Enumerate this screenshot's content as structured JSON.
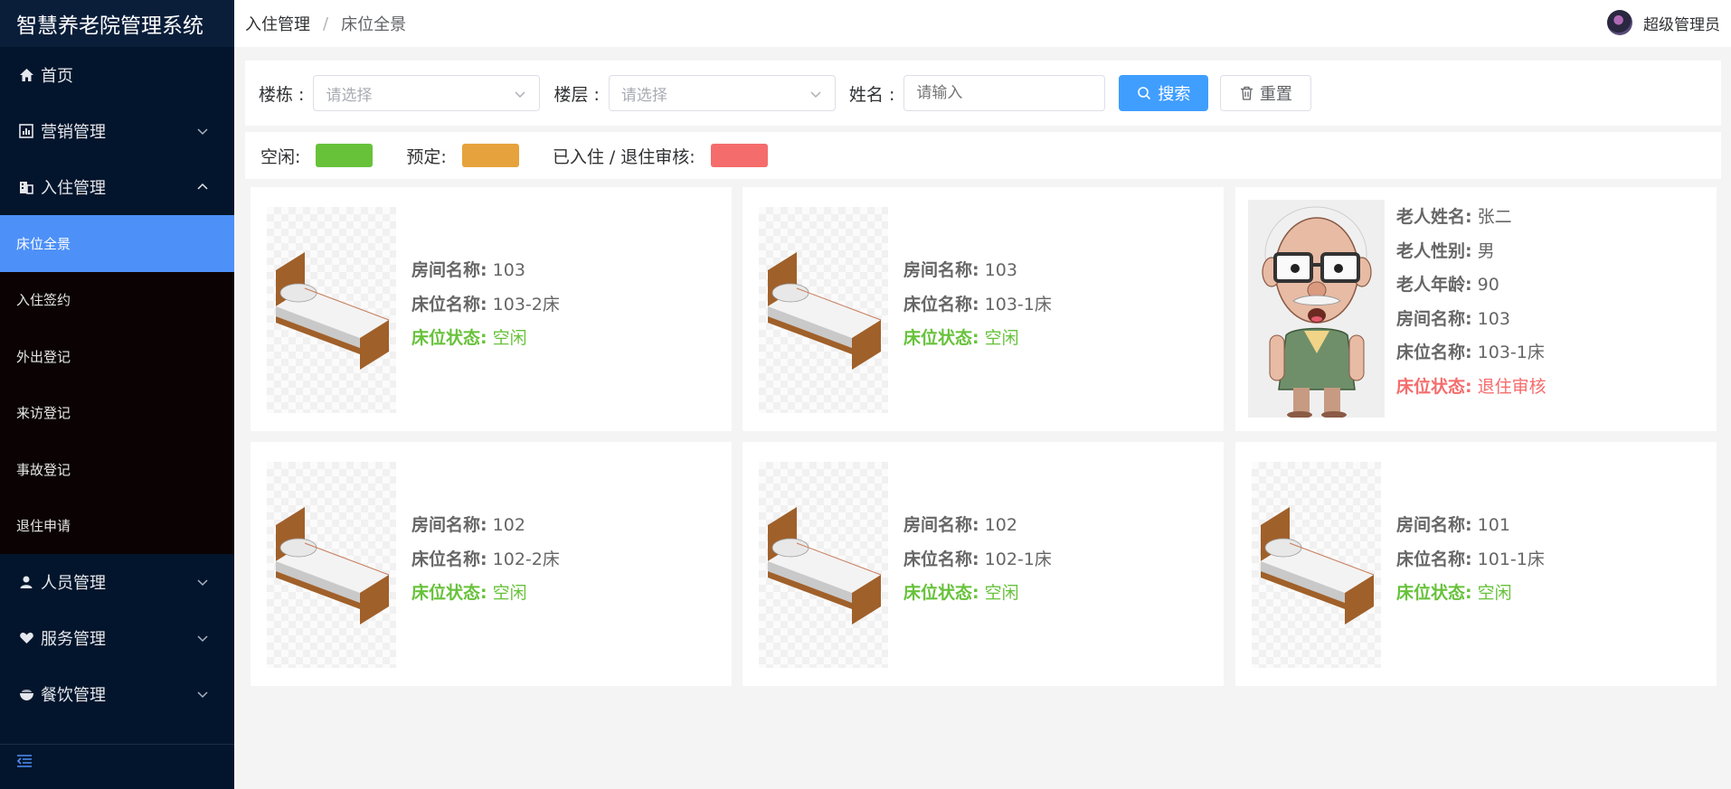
{
  "app": {
    "title": "智慧养老院管理系统"
  },
  "sidebar": {
    "home": {
      "label": "首页",
      "icon": "home-icon"
    },
    "marketing": {
      "label": "营销管理",
      "icon": "chart-icon"
    },
    "checkin": {
      "label": "入住管理",
      "icon": "building-icon",
      "items": [
        {
          "label": "床位全景",
          "active": true
        },
        {
          "label": "入住签约"
        },
        {
          "label": "外出登记"
        },
        {
          "label": "来访登记"
        },
        {
          "label": "事故登记"
        },
        {
          "label": "退住申请"
        }
      ]
    },
    "personnel": {
      "label": "人员管理",
      "icon": "user-icon"
    },
    "service": {
      "label": "服务管理",
      "icon": "heart-hand-icon"
    },
    "catering": {
      "label": "餐饮管理",
      "icon": "bowl-icon"
    }
  },
  "header": {
    "breadcrumb": [
      "入住管理",
      "床位全景"
    ],
    "separator": "/",
    "user": "超级管理员"
  },
  "filter": {
    "building_label": "楼栋 :",
    "building_placeholder": "请选择",
    "floor_label": "楼层 :",
    "floor_placeholder": "请选择",
    "name_label": "姓名 :",
    "name_placeholder": "请输入",
    "search_label": "搜索",
    "reset_label": "重置"
  },
  "legend": {
    "idle": {
      "label": "空闲:",
      "color": "#67c23a"
    },
    "reserved": {
      "label": "预定:",
      "color": "#e6a23c"
    },
    "occupied": {
      "label": "已入住 / 退住审核:",
      "color": "#f56c6c"
    }
  },
  "labels": {
    "room": "房间名称:",
    "bed": "床位名称:",
    "status": "床位状态:",
    "elder_name": "老人姓名:",
    "elder_gender": "老人性别:",
    "elder_age": "老人年龄:"
  },
  "beds": [
    {
      "room": "103",
      "bed": "103-2床",
      "status": "空闲"
    },
    {
      "room": "103",
      "bed": "103-1床",
      "status": "空闲"
    },
    {
      "room": "103",
      "bed": "103-1床",
      "status": "退住审核",
      "elder_name": "张二",
      "elder_gender": "男",
      "elder_age": "90"
    },
    {
      "room": "102",
      "bed": "102-2床",
      "status": "空闲"
    },
    {
      "room": "102",
      "bed": "102-1床",
      "status": "空闲"
    },
    {
      "room": "101",
      "bed": "101-1床",
      "status": "空闲"
    }
  ]
}
